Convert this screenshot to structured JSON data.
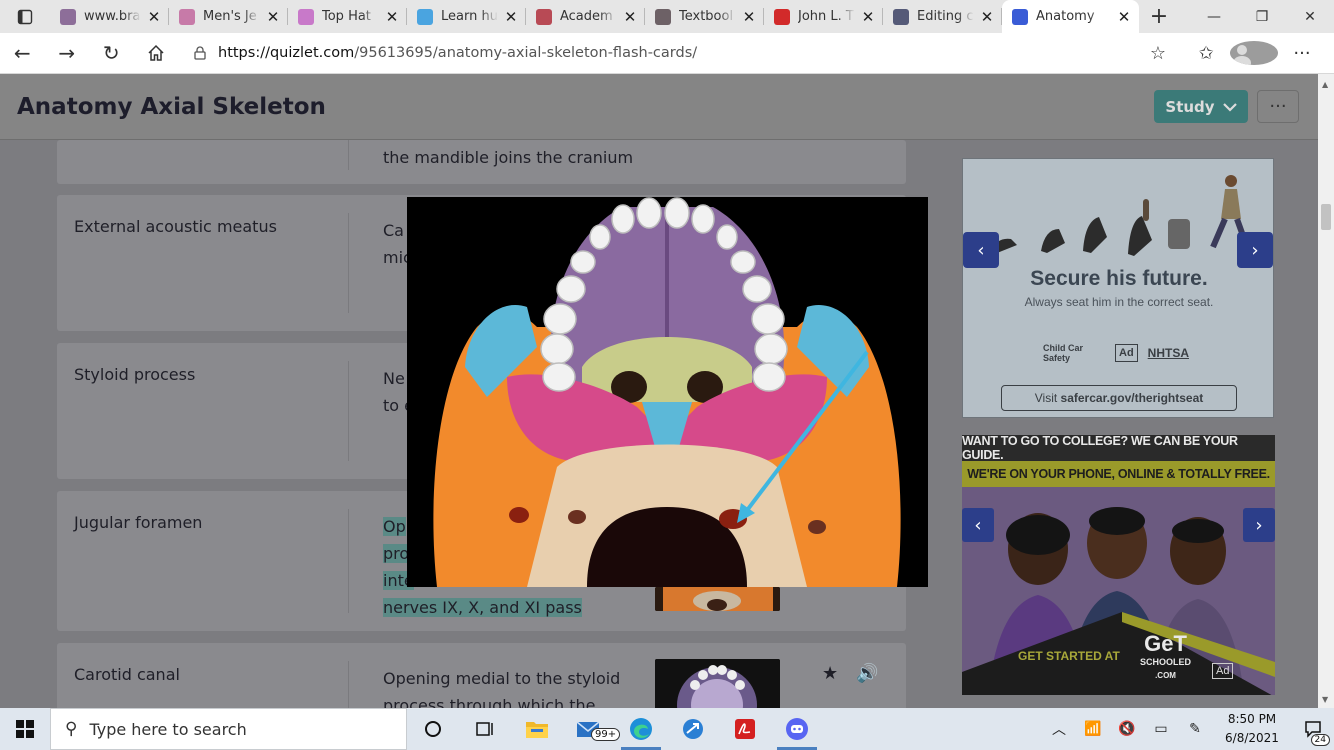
{
  "browser": {
    "tabs": [
      {
        "title": "www.bra",
        "favicon": "globe-icon",
        "color": "#8d6e99"
      },
      {
        "title": "Men's Je",
        "favicon": "pinwheel-icon",
        "color": "#c77aa8"
      },
      {
        "title": "Top Hat",
        "favicon": "top-hat-icon",
        "color": "#c879c9"
      },
      {
        "title": "Learn hu",
        "favicon": "k-icon",
        "color": "#4aa4e0"
      },
      {
        "title": "Academ",
        "favicon": "my-icon",
        "color": "#b84a55"
      },
      {
        "title": "Textbool",
        "favicon": "textbook-icon",
        "color": "#6d6166"
      },
      {
        "title": "John L. T",
        "favicon": "pdf-icon",
        "color": "#d22a2a"
      },
      {
        "title": "Editing c",
        "favicon": "editing-icon",
        "color": "#555a78"
      },
      {
        "title": "Anatomy",
        "favicon": "quizlet-icon",
        "color": "#3a5cd6",
        "active": true
      }
    ],
    "new_tab_symbol": "+",
    "url_host": "https://quizlet.com",
    "url_path": "/95613695/anatomy-axial-skeleton-flash-cards/"
  },
  "set": {
    "title": "Anatomy Axial Skeleton",
    "study_label": "Study",
    "more_label": "···"
  },
  "cards": [
    {
      "term": "",
      "definition": "the mandible joins the cranium"
    },
    {
      "term": "External acoustic meatus",
      "definition_lines": [
        "Ca",
        "mic"
      ]
    },
    {
      "term": "Styloid process",
      "definition_lines": [
        "Ne",
        "to e"
      ]
    },
    {
      "term": "Jugular foramen",
      "definition_lines": [
        "Op",
        "pro",
        "inte",
        "nerves IX, X, and XI pass"
      ]
    },
    {
      "term": "Carotid canal",
      "definition_lines": [
        "Opening medial to the styloid",
        "process through which the"
      ]
    }
  ],
  "ads": {
    "ad1": {
      "headline": "Secure his future.",
      "sub": "Always seat him in the correct seat.",
      "logo1": "Child Car Safety",
      "logo2": "Ad",
      "logo3": "NHTSA",
      "cta_prefix": "Visit ",
      "cta_link": "safercar.gov/therightseat"
    },
    "ad2": {
      "line1": "WANT TO GO TO COLLEGE? WE CAN BE YOUR GUIDE.",
      "line2": "WE'RE ON YOUR PHONE, ONLINE & TOTALLY FREE.",
      "get_started": "GET STARTED AT",
      "brand": "GeT",
      "brand_sub": "SCHOOLED",
      "brand_com": ".COM",
      "ad_council": "Ad"
    }
  },
  "taskbar": {
    "search_placeholder": "Type here to search",
    "mail_badge": "99+",
    "time": "8:50 PM",
    "date": "6/8/2021",
    "notif_count": "24"
  }
}
